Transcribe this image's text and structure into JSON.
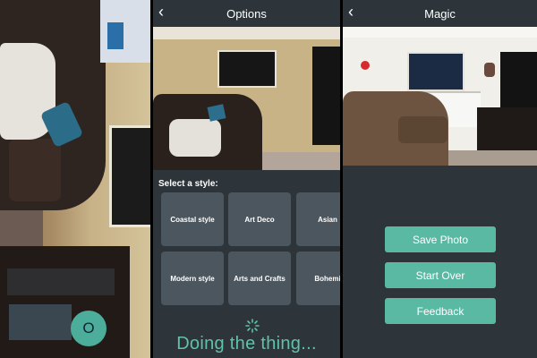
{
  "panel1": {
    "shutter_label": "O"
  },
  "panel2": {
    "header": {
      "back_glyph": "‹",
      "title": "Options"
    },
    "style_label": "Select a style:",
    "styles": [
      "Coastal style",
      "Art Deco",
      "Asian",
      "Modern style",
      "Arts and Crafts",
      "Bohemi"
    ],
    "loading_text": "Doing the thing..."
  },
  "panel3": {
    "header": {
      "back_glyph": "‹",
      "title": "Magic"
    },
    "buttons": {
      "save": "Save Photo",
      "start_over": "Start Over",
      "feedback": "Feedback"
    }
  },
  "colors": {
    "accent": "#5ab9a3",
    "tile_bg": "#4b565e",
    "bg": "#2d353a"
  }
}
